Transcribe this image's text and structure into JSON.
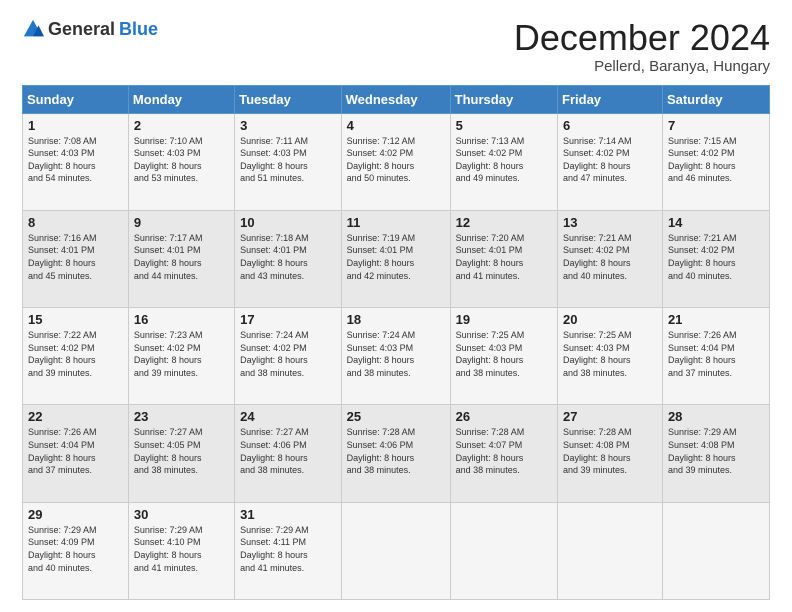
{
  "header": {
    "logo_general": "General",
    "logo_blue": "Blue",
    "month_title": "December 2024",
    "location": "Pellerd, Baranya, Hungary"
  },
  "days_of_week": [
    "Sunday",
    "Monday",
    "Tuesday",
    "Wednesday",
    "Thursday",
    "Friday",
    "Saturday"
  ],
  "weeks": [
    [
      {
        "day": "1",
        "sunrise": "7:08 AM",
        "sunset": "4:03 PM",
        "daylight": "8 hours and 54 minutes."
      },
      {
        "day": "2",
        "sunrise": "7:10 AM",
        "sunset": "4:03 PM",
        "daylight": "8 hours and 53 minutes."
      },
      {
        "day": "3",
        "sunrise": "7:11 AM",
        "sunset": "4:03 PM",
        "daylight": "8 hours and 51 minutes."
      },
      {
        "day": "4",
        "sunrise": "7:12 AM",
        "sunset": "4:02 PM",
        "daylight": "8 hours and 50 minutes."
      },
      {
        "day": "5",
        "sunrise": "7:13 AM",
        "sunset": "4:02 PM",
        "daylight": "8 hours and 49 minutes."
      },
      {
        "day": "6",
        "sunrise": "7:14 AM",
        "sunset": "4:02 PM",
        "daylight": "8 hours and 47 minutes."
      },
      {
        "day": "7",
        "sunrise": "7:15 AM",
        "sunset": "4:02 PM",
        "daylight": "8 hours and 46 minutes."
      }
    ],
    [
      {
        "day": "8",
        "sunrise": "7:16 AM",
        "sunset": "4:01 PM",
        "daylight": "8 hours and 45 minutes."
      },
      {
        "day": "9",
        "sunrise": "7:17 AM",
        "sunset": "4:01 PM",
        "daylight": "8 hours and 44 minutes."
      },
      {
        "day": "10",
        "sunrise": "7:18 AM",
        "sunset": "4:01 PM",
        "daylight": "8 hours and 43 minutes."
      },
      {
        "day": "11",
        "sunrise": "7:19 AM",
        "sunset": "4:01 PM",
        "daylight": "8 hours and 42 minutes."
      },
      {
        "day": "12",
        "sunrise": "7:20 AM",
        "sunset": "4:01 PM",
        "daylight": "8 hours and 41 minutes."
      },
      {
        "day": "13",
        "sunrise": "7:21 AM",
        "sunset": "4:02 PM",
        "daylight": "8 hours and 40 minutes."
      },
      {
        "day": "14",
        "sunrise": "7:21 AM",
        "sunset": "4:02 PM",
        "daylight": "8 hours and 40 minutes."
      }
    ],
    [
      {
        "day": "15",
        "sunrise": "7:22 AM",
        "sunset": "4:02 PM",
        "daylight": "8 hours and 39 minutes."
      },
      {
        "day": "16",
        "sunrise": "7:23 AM",
        "sunset": "4:02 PM",
        "daylight": "8 hours and 39 minutes."
      },
      {
        "day": "17",
        "sunrise": "7:24 AM",
        "sunset": "4:02 PM",
        "daylight": "8 hours and 38 minutes."
      },
      {
        "day": "18",
        "sunrise": "7:24 AM",
        "sunset": "4:03 PM",
        "daylight": "8 hours and 38 minutes."
      },
      {
        "day": "19",
        "sunrise": "7:25 AM",
        "sunset": "4:03 PM",
        "daylight": "8 hours and 38 minutes."
      },
      {
        "day": "20",
        "sunrise": "7:25 AM",
        "sunset": "4:03 PM",
        "daylight": "8 hours and 38 minutes."
      },
      {
        "day": "21",
        "sunrise": "7:26 AM",
        "sunset": "4:04 PM",
        "daylight": "8 hours and 37 minutes."
      }
    ],
    [
      {
        "day": "22",
        "sunrise": "7:26 AM",
        "sunset": "4:04 PM",
        "daylight": "8 hours and 37 minutes."
      },
      {
        "day": "23",
        "sunrise": "7:27 AM",
        "sunset": "4:05 PM",
        "daylight": "8 hours and 38 minutes."
      },
      {
        "day": "24",
        "sunrise": "7:27 AM",
        "sunset": "4:06 PM",
        "daylight": "8 hours and 38 minutes."
      },
      {
        "day": "25",
        "sunrise": "7:28 AM",
        "sunset": "4:06 PM",
        "daylight": "8 hours and 38 minutes."
      },
      {
        "day": "26",
        "sunrise": "7:28 AM",
        "sunset": "4:07 PM",
        "daylight": "8 hours and 38 minutes."
      },
      {
        "day": "27",
        "sunrise": "7:28 AM",
        "sunset": "4:08 PM",
        "daylight": "8 hours and 39 minutes."
      },
      {
        "day": "28",
        "sunrise": "7:29 AM",
        "sunset": "4:08 PM",
        "daylight": "8 hours and 39 minutes."
      }
    ],
    [
      {
        "day": "29",
        "sunrise": "7:29 AM",
        "sunset": "4:09 PM",
        "daylight": "8 hours and 40 minutes."
      },
      {
        "day": "30",
        "sunrise": "7:29 AM",
        "sunset": "4:10 PM",
        "daylight": "8 hours and 41 minutes."
      },
      {
        "day": "31",
        "sunrise": "7:29 AM",
        "sunset": "4:11 PM",
        "daylight": "8 hours and 41 minutes."
      },
      null,
      null,
      null,
      null
    ]
  ],
  "labels": {
    "sunrise": "Sunrise:",
    "sunset": "Sunset:",
    "daylight": "Daylight:"
  }
}
